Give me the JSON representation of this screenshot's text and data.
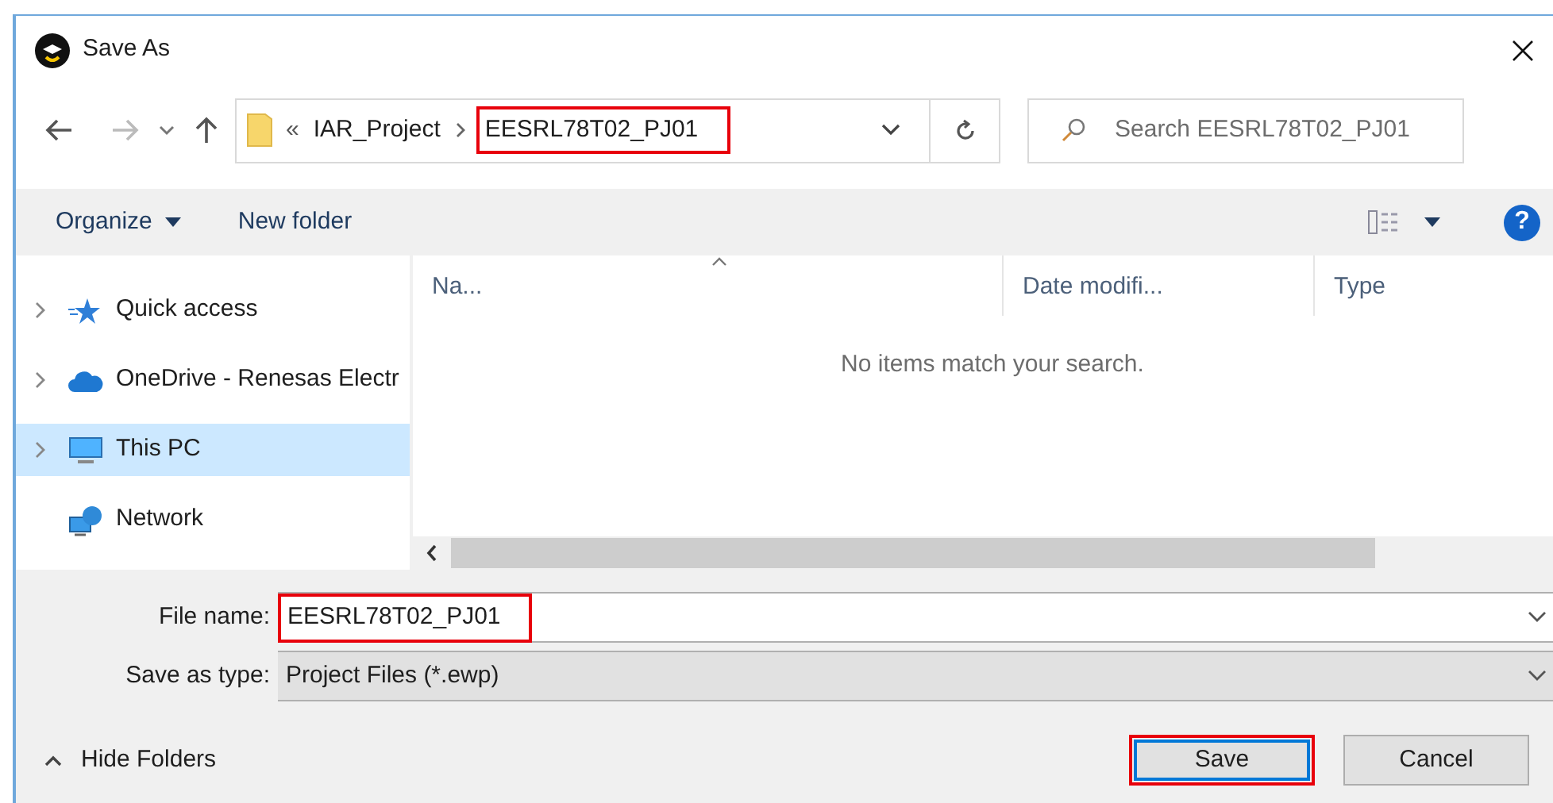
{
  "window": {
    "title": "Save As"
  },
  "address_bar": {
    "overflow": "«",
    "crumbs": [
      {
        "label": "IAR_Project",
        "highlighted": false
      },
      {
        "label": "EESRL78T02_PJ01",
        "highlighted": true
      }
    ]
  },
  "search": {
    "placeholder": "Search EESRL78T02_PJ01"
  },
  "toolbar": {
    "buttons": [
      {
        "label": "Organize",
        "kind": "menu"
      },
      {
        "label": "New folder",
        "kind": "plain"
      }
    ],
    "help": "?"
  },
  "sidebar": {
    "items": [
      {
        "label": "Quick access",
        "kind": "star",
        "expandable": true,
        "selected": false
      },
      {
        "label": "OneDrive - Renesas Electr",
        "kind": "cloud",
        "expandable": true,
        "selected": false
      },
      {
        "label": "This PC",
        "kind": "computer",
        "expandable": true,
        "selected": true
      },
      {
        "label": "Network",
        "kind": "network",
        "expandable": false,
        "selected": false
      }
    ]
  },
  "file_list": {
    "columns": [
      {
        "label": "Na...",
        "sorted": true
      },
      {
        "label": "Date modifi...",
        "sorted": false
      },
      {
        "label": "Type",
        "sorted": false
      }
    ],
    "empty_message": "No items match your search."
  },
  "file_name": {
    "label": "File name:",
    "value": "EESRL78T02_PJ01",
    "highlighted": true
  },
  "save_as_type": {
    "label": "Save as type:",
    "value": "Project Files (*.ewp)"
  },
  "hide_folders": "Hide Folders",
  "buttons": [
    {
      "label": "Save",
      "default": true,
      "highlighted": true
    },
    {
      "label": "Cancel",
      "default": false,
      "highlighted": false
    }
  ]
}
